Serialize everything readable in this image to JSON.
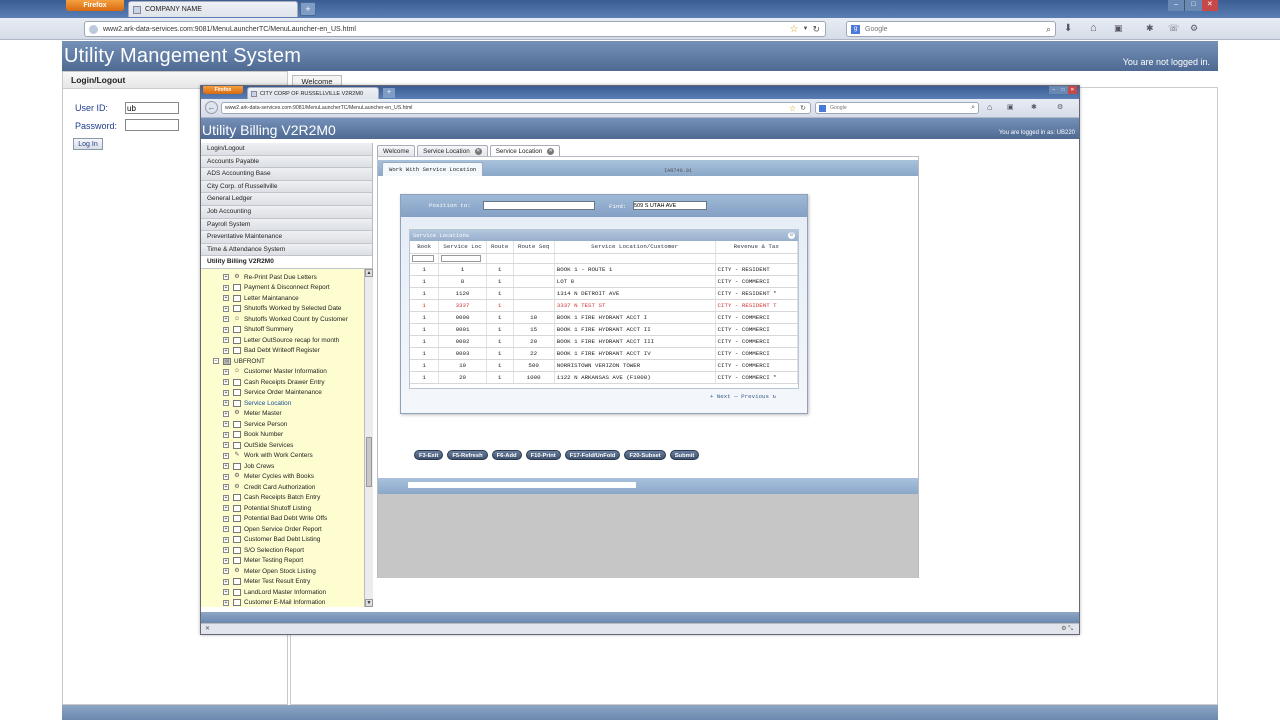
{
  "outer_browser": {
    "firefox_label": "Firefox",
    "tab_title": "COMPANY NAME",
    "new_tab": "+",
    "url": "www2.ark-data-services.com:9081/MenuLauncherTC/MenuLauncher-en_US.html",
    "search_placeholder": "Google"
  },
  "outer_app": {
    "title": "Utility Mangement System",
    "login_status": "You are not logged in.",
    "login_panel_title": "Login/Logout",
    "welcome_tab": "Welcome",
    "user_id_label": "User ID:",
    "user_id_value": "ub",
    "password_label": "Password:",
    "login_button": "Log In"
  },
  "inner_browser": {
    "firefox_label": "Firefox",
    "tab_title": "CITY CORP OF RUSSELLVILLE V2R2M0",
    "new_tab": "+",
    "url": "www2.ark-data-services.com:9081/MenuLauncherTC/MenuLauncher-en_US.html",
    "search_placeholder": "Google"
  },
  "inner_app": {
    "title": "Utility Billing V2R2M0",
    "logged_in_as": "You are logged in as: UB220"
  },
  "nav_menu": [
    {
      "label": "Login/Logout",
      "active": false
    },
    {
      "label": "Accounts Payable",
      "active": false
    },
    {
      "label": "ADS Accounting Base",
      "active": false
    },
    {
      "label": "City Corp. of Russellville",
      "active": false
    },
    {
      "label": "General Ledger",
      "active": false
    },
    {
      "label": "Job Accounting",
      "active": false
    },
    {
      "label": "Payroll System",
      "active": false
    },
    {
      "label": "Preventative Maintenance",
      "active": false
    },
    {
      "label": "Time & Attendance System",
      "active": false
    },
    {
      "label": "Utility Billing V2R2M0",
      "active": true
    }
  ],
  "tree_items": [
    {
      "label": "Re-Print Past Due Letters",
      "level": 1,
      "icon": "gear"
    },
    {
      "label": "Payment & Disconnect Report",
      "level": 1,
      "icon": "doc"
    },
    {
      "label": "Letter Maintanance",
      "level": 1,
      "icon": "doc"
    },
    {
      "label": "Shutoffs Worked by Selected Date",
      "level": 1,
      "icon": "doc"
    },
    {
      "label": "Shutoffs Worked Count by Customer",
      "level": 1,
      "icon": "people"
    },
    {
      "label": "Shutoff Summery",
      "level": 1,
      "icon": "doc"
    },
    {
      "label": "Letter OutSource recap for month",
      "level": 1,
      "icon": "doc"
    },
    {
      "label": "Bad Debt Writeoff Register",
      "level": 1,
      "icon": "doc"
    },
    {
      "label": "UBFRONT",
      "level": 0,
      "icon": "folder"
    },
    {
      "label": "Customer Master Information",
      "level": 1,
      "icon": "people"
    },
    {
      "label": "Cash Receipts Drawer Entry",
      "level": 1,
      "icon": "doc"
    },
    {
      "label": "Service Order Maintenance",
      "level": 1,
      "icon": "doc"
    },
    {
      "label": "Service Location",
      "level": 1,
      "icon": "doc",
      "link": true
    },
    {
      "label": "Meter Master",
      "level": 1,
      "icon": "gear"
    },
    {
      "label": "Service Person",
      "level": 1,
      "icon": "doc"
    },
    {
      "label": "Book Number",
      "level": 1,
      "icon": "doc"
    },
    {
      "label": "OutSide Services",
      "level": 1,
      "icon": "doc"
    },
    {
      "label": "Work with Work Centers",
      "level": 1,
      "icon": "wrench"
    },
    {
      "label": "Job Crews",
      "level": 1,
      "icon": "doc"
    },
    {
      "label": "Meter Cycles with Books",
      "level": 1,
      "icon": "gear"
    },
    {
      "label": "Credit Card Authorization",
      "level": 1,
      "icon": "gear"
    },
    {
      "label": "Cash Receipts Batch Entry",
      "level": 1,
      "icon": "doc"
    },
    {
      "label": "Potential Shutoff Listing",
      "level": 1,
      "icon": "doc"
    },
    {
      "label": "Potential Bad Debt Write Offs",
      "level": 1,
      "icon": "doc"
    },
    {
      "label": "Open Service Order Report",
      "level": 1,
      "icon": "doc"
    },
    {
      "label": "Customer Bad Debt Listing",
      "level": 1,
      "icon": "doc"
    },
    {
      "label": "S/O Selection Report",
      "level": 1,
      "icon": "doc"
    },
    {
      "label": "Meter Testing Report",
      "level": 1,
      "icon": "doc"
    },
    {
      "label": "Meter Open Stock Listing",
      "level": 1,
      "icon": "gear"
    },
    {
      "label": "Meter Test Result Entry",
      "level": 1,
      "icon": "doc"
    },
    {
      "label": "LandLord Master Information",
      "level": 1,
      "icon": "doc"
    },
    {
      "label": "Customer E-Mail Information",
      "level": 1,
      "icon": "doc"
    }
  ],
  "main_tabs": [
    {
      "label": "Welcome",
      "closable": false
    },
    {
      "label": "Service Location",
      "closable": true
    },
    {
      "label": "Service Location",
      "closable": true
    }
  ],
  "work_panel": {
    "tab_label": "Work With Service Location",
    "program_id": "IAR740.01"
  },
  "search_form": {
    "position_label": "Position to:",
    "position_value": "",
    "find_label": "Find:",
    "find_value": "509 S UTAH AVE"
  },
  "grid": {
    "title": "Service Locations",
    "columns": [
      "Book",
      "Service Loc",
      "Route",
      "Route Seq",
      "Service Location/Customer",
      "Revenue & Tax"
    ],
    "rows": [
      {
        "book": "1",
        "loc": "1",
        "route": "1",
        "seq": "",
        "desc": "BOOK 1 - ROUTE 1",
        "rev": "CITY - RESIDENT",
        "highlight": false
      },
      {
        "book": "1",
        "loc": "8",
        "route": "1",
        "seq": "",
        "desc": "LOT 8",
        "rev": "CITY - COMMERCI",
        "highlight": false
      },
      {
        "book": "1",
        "loc": "1120",
        "route": "1",
        "seq": "",
        "desc": "1314 N DETROIT AVE",
        "rev": "CITY - RESIDENT *",
        "highlight": false
      },
      {
        "book": "1",
        "loc": "3337",
        "route": "1",
        "seq": "",
        "desc": "3337 N TEST ST",
        "rev": "CITY - RESIDENT T",
        "highlight": true
      },
      {
        "book": "1",
        "loc": "9000",
        "route": "1",
        "seq": "10",
        "desc": "BOOK 1 FIRE HYDRANT ACCT I",
        "rev": "CITY - COMMERCI",
        "highlight": false
      },
      {
        "book": "1",
        "loc": "9001",
        "route": "1",
        "seq": "15",
        "desc": "BOOK 1 FIRE HYDRANT ACCT II",
        "rev": "CITY - COMMERCI",
        "highlight": false
      },
      {
        "book": "1",
        "loc": "9002",
        "route": "1",
        "seq": "20",
        "desc": "BOOK 1 FIRE HYDRANT ACCT III",
        "rev": "CITY - COMMERCI",
        "highlight": false
      },
      {
        "book": "1",
        "loc": "9003",
        "route": "1",
        "seq": "22",
        "desc": "BOOK 1 FIRE HYDRANT ACCT IV",
        "rev": "CITY - COMMERCI",
        "highlight": false
      },
      {
        "book": "1",
        "loc": "10",
        "route": "1",
        "seq": "500",
        "desc": "NORRISTOWN VERIZON TOWER",
        "rev": "CITY - COMMERCI",
        "highlight": false
      },
      {
        "book": "1",
        "loc": "20",
        "route": "1",
        "seq": "1000",
        "desc": "1122 N ARKANSAS AVE (F1000)",
        "rev": "CITY - COMMERCI *",
        "highlight": false
      }
    ],
    "next_label": "Next",
    "previous_label": "Previous"
  },
  "function_keys": [
    "F3-Exit",
    "F5-Refresh",
    "F6-Add",
    "F10-Print",
    "F17-Fold/UnFold",
    "F20-Subset",
    "Submit"
  ],
  "colors": {
    "app_banner": "#5a759b",
    "tree_background": "#fdfdd0",
    "highlight_row": "#d23030",
    "fkey_button": "#4a5e7c"
  }
}
